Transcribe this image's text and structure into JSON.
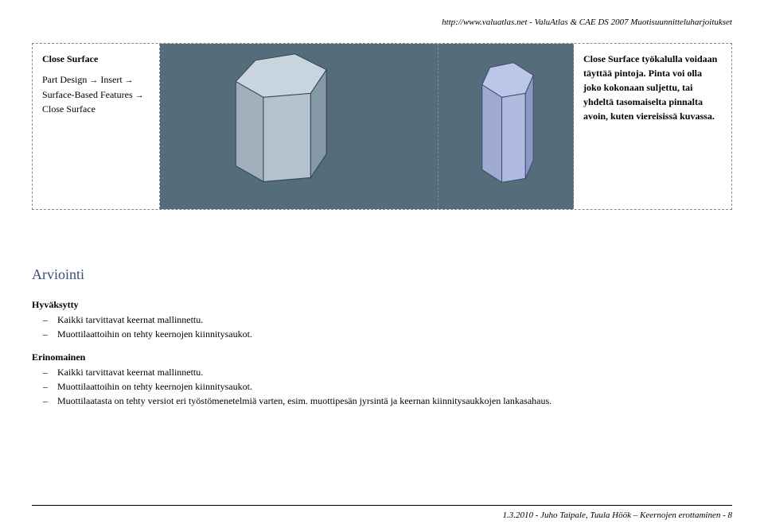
{
  "header": {
    "url": "http://www.valuatlas.net - ValuAtlas & CAE DS 2007 Muotisuunnitteluharjoitukset"
  },
  "box": {
    "title": "Close Surface",
    "path_line1_a": "Part Design ",
    "path_line1_b": " Insert ",
    "path_line2_a": "Surface-Based Features ",
    "path_line3": "Close Surface",
    "desc": "Close Surface työkalulla voidaan täyttää pintoja. Pinta voi olla joko kokonaan suljettu, tai yhdeltä tasomaiselta pinnalta avoin, kuten viereisissä kuvassa."
  },
  "arviointi": {
    "title": "Arviointi",
    "hyvaksytty": {
      "label": "Hyväksytty",
      "items": [
        "Kaikki tarvittavat keernat mallinnettu.",
        "Muottilaattoihin on tehty keernojen kiinnitysaukot."
      ]
    },
    "erinomainen": {
      "label": "Erinomainen",
      "items": [
        "Kaikki tarvittavat keernat mallinnettu.",
        "Muottilaattoihin on tehty keernojen kiinnitysaukot.",
        "Muottilaatasta on tehty versiot eri työstömenetelmiä varten, esim. muottipesän jyrsintä ja keernan kiinnitysaukkojen lankasahaus."
      ]
    }
  },
  "footer": {
    "text": "1.3.2010 - Juho Taipale, Tuula Höök – Keernojen erottaminen - 8"
  }
}
